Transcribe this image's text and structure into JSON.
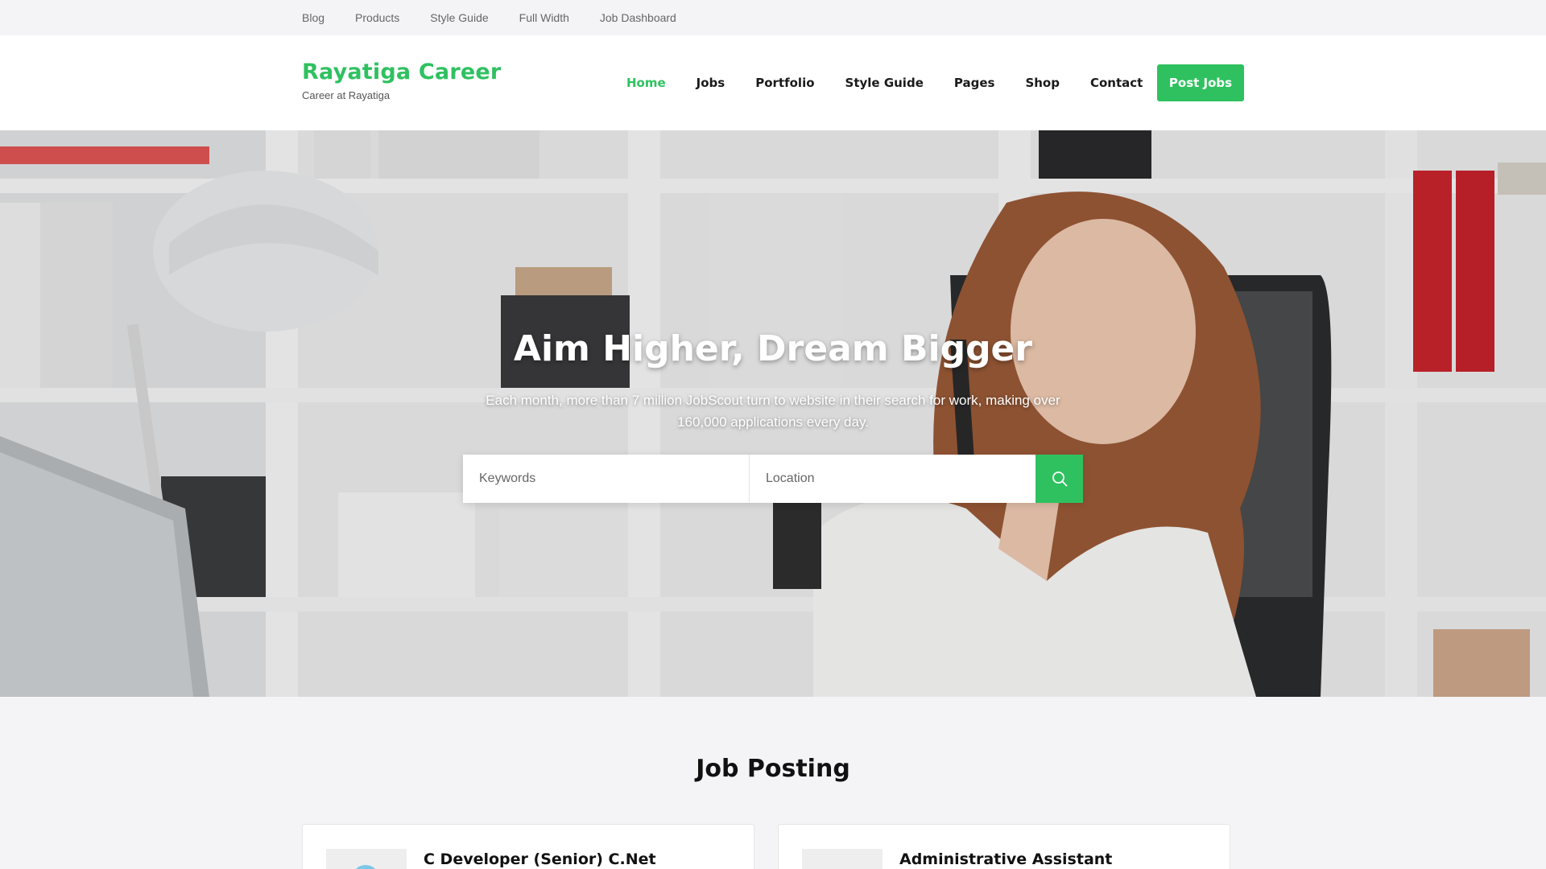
{
  "topbar": {
    "links": [
      "Blog",
      "Products",
      "Style Guide",
      "Full Width",
      "Job Dashboard"
    ]
  },
  "brand": {
    "title": "Rayatiga Career",
    "tagline": "Career at Rayatiga"
  },
  "nav": {
    "items": [
      "Home",
      "Jobs",
      "Portfolio",
      "Style Guide",
      "Pages",
      "Shop",
      "Contact"
    ],
    "active": "Home",
    "cta": "Post Jobs"
  },
  "hero": {
    "title": "Aim Higher, Dream Bigger",
    "subtitle": "Each month, more than 7 million JobScout turn to website in their search for work, making over 160,000 applications every day.",
    "keywords_placeholder": "Keywords",
    "location_placeholder": "Location",
    "search_icon": "search-icon"
  },
  "jobs": {
    "section_title": "Job Posting",
    "cards": [
      {
        "title": "C Developer (Senior) C.Net"
      },
      {
        "title": "Administrative Assistant"
      }
    ]
  },
  "colors": {
    "accent": "#2fc160",
    "topbar_bg": "#f4f4f6",
    "header_bg": "#ffffff"
  }
}
